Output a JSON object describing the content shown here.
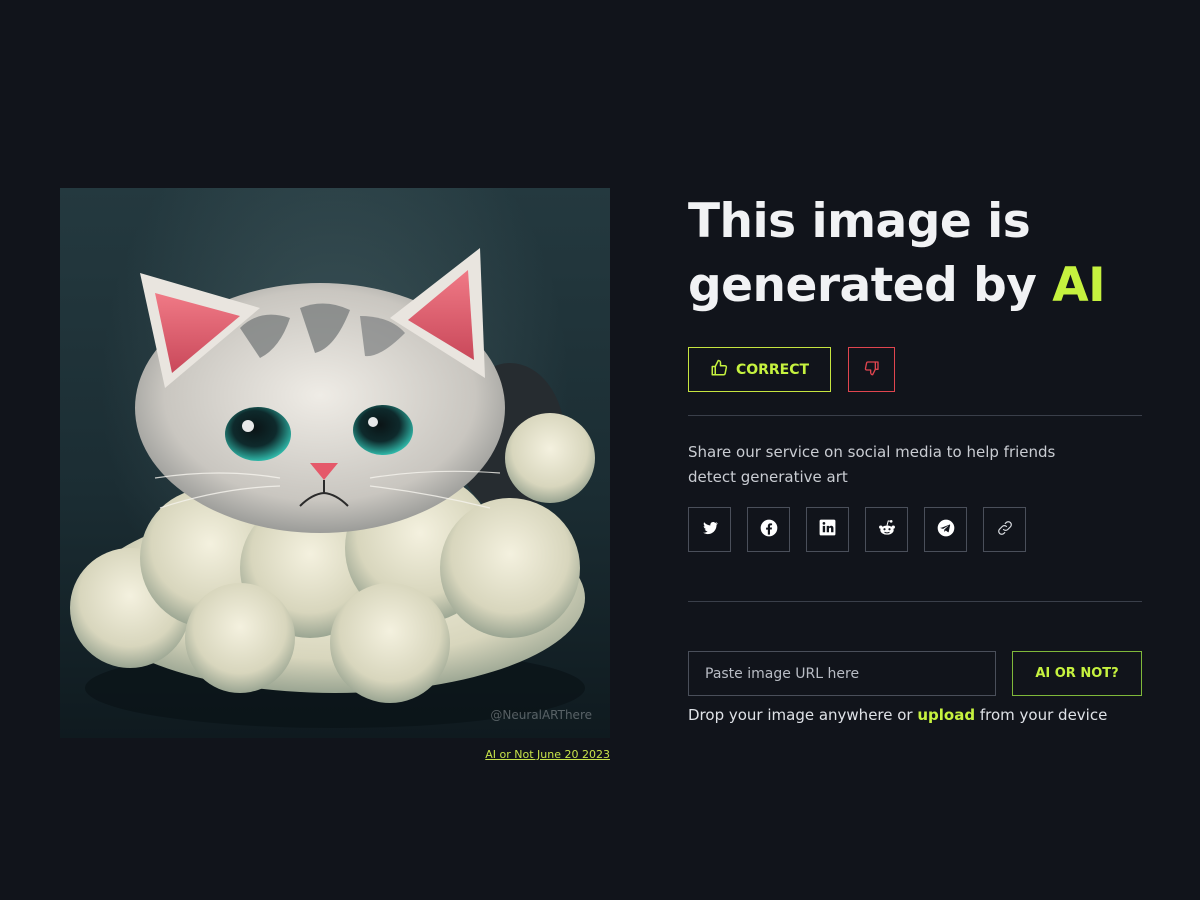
{
  "image": {
    "watermark": "@NeuralARThere",
    "caption_link": "AI or Not June 20 2023"
  },
  "verdict": {
    "line1": "This image is",
    "line2_prefix": "generated by ",
    "line2_highlight": "AI",
    "highlight_color": "#c6f23f"
  },
  "feedback": {
    "correct_label": "CORRECT",
    "correct_icon": "thumbs-up-icon",
    "incorrect_icon": "thumbs-down-icon"
  },
  "share": {
    "text": "Share our service on social media to help friends detect generative art",
    "icons": [
      "twitter-icon",
      "facebook-icon",
      "linkedin-icon",
      "reddit-icon",
      "telegram-icon",
      "link-icon"
    ]
  },
  "check": {
    "placeholder": "Paste image URL here",
    "button_label": "AI OR NOT?",
    "drop_prefix": "Drop your image anywhere or ",
    "drop_link": "upload",
    "drop_suffix": " from your device"
  },
  "colors": {
    "background": "#11141b",
    "accent": "#c6f23f",
    "danger": "#e0454f"
  }
}
